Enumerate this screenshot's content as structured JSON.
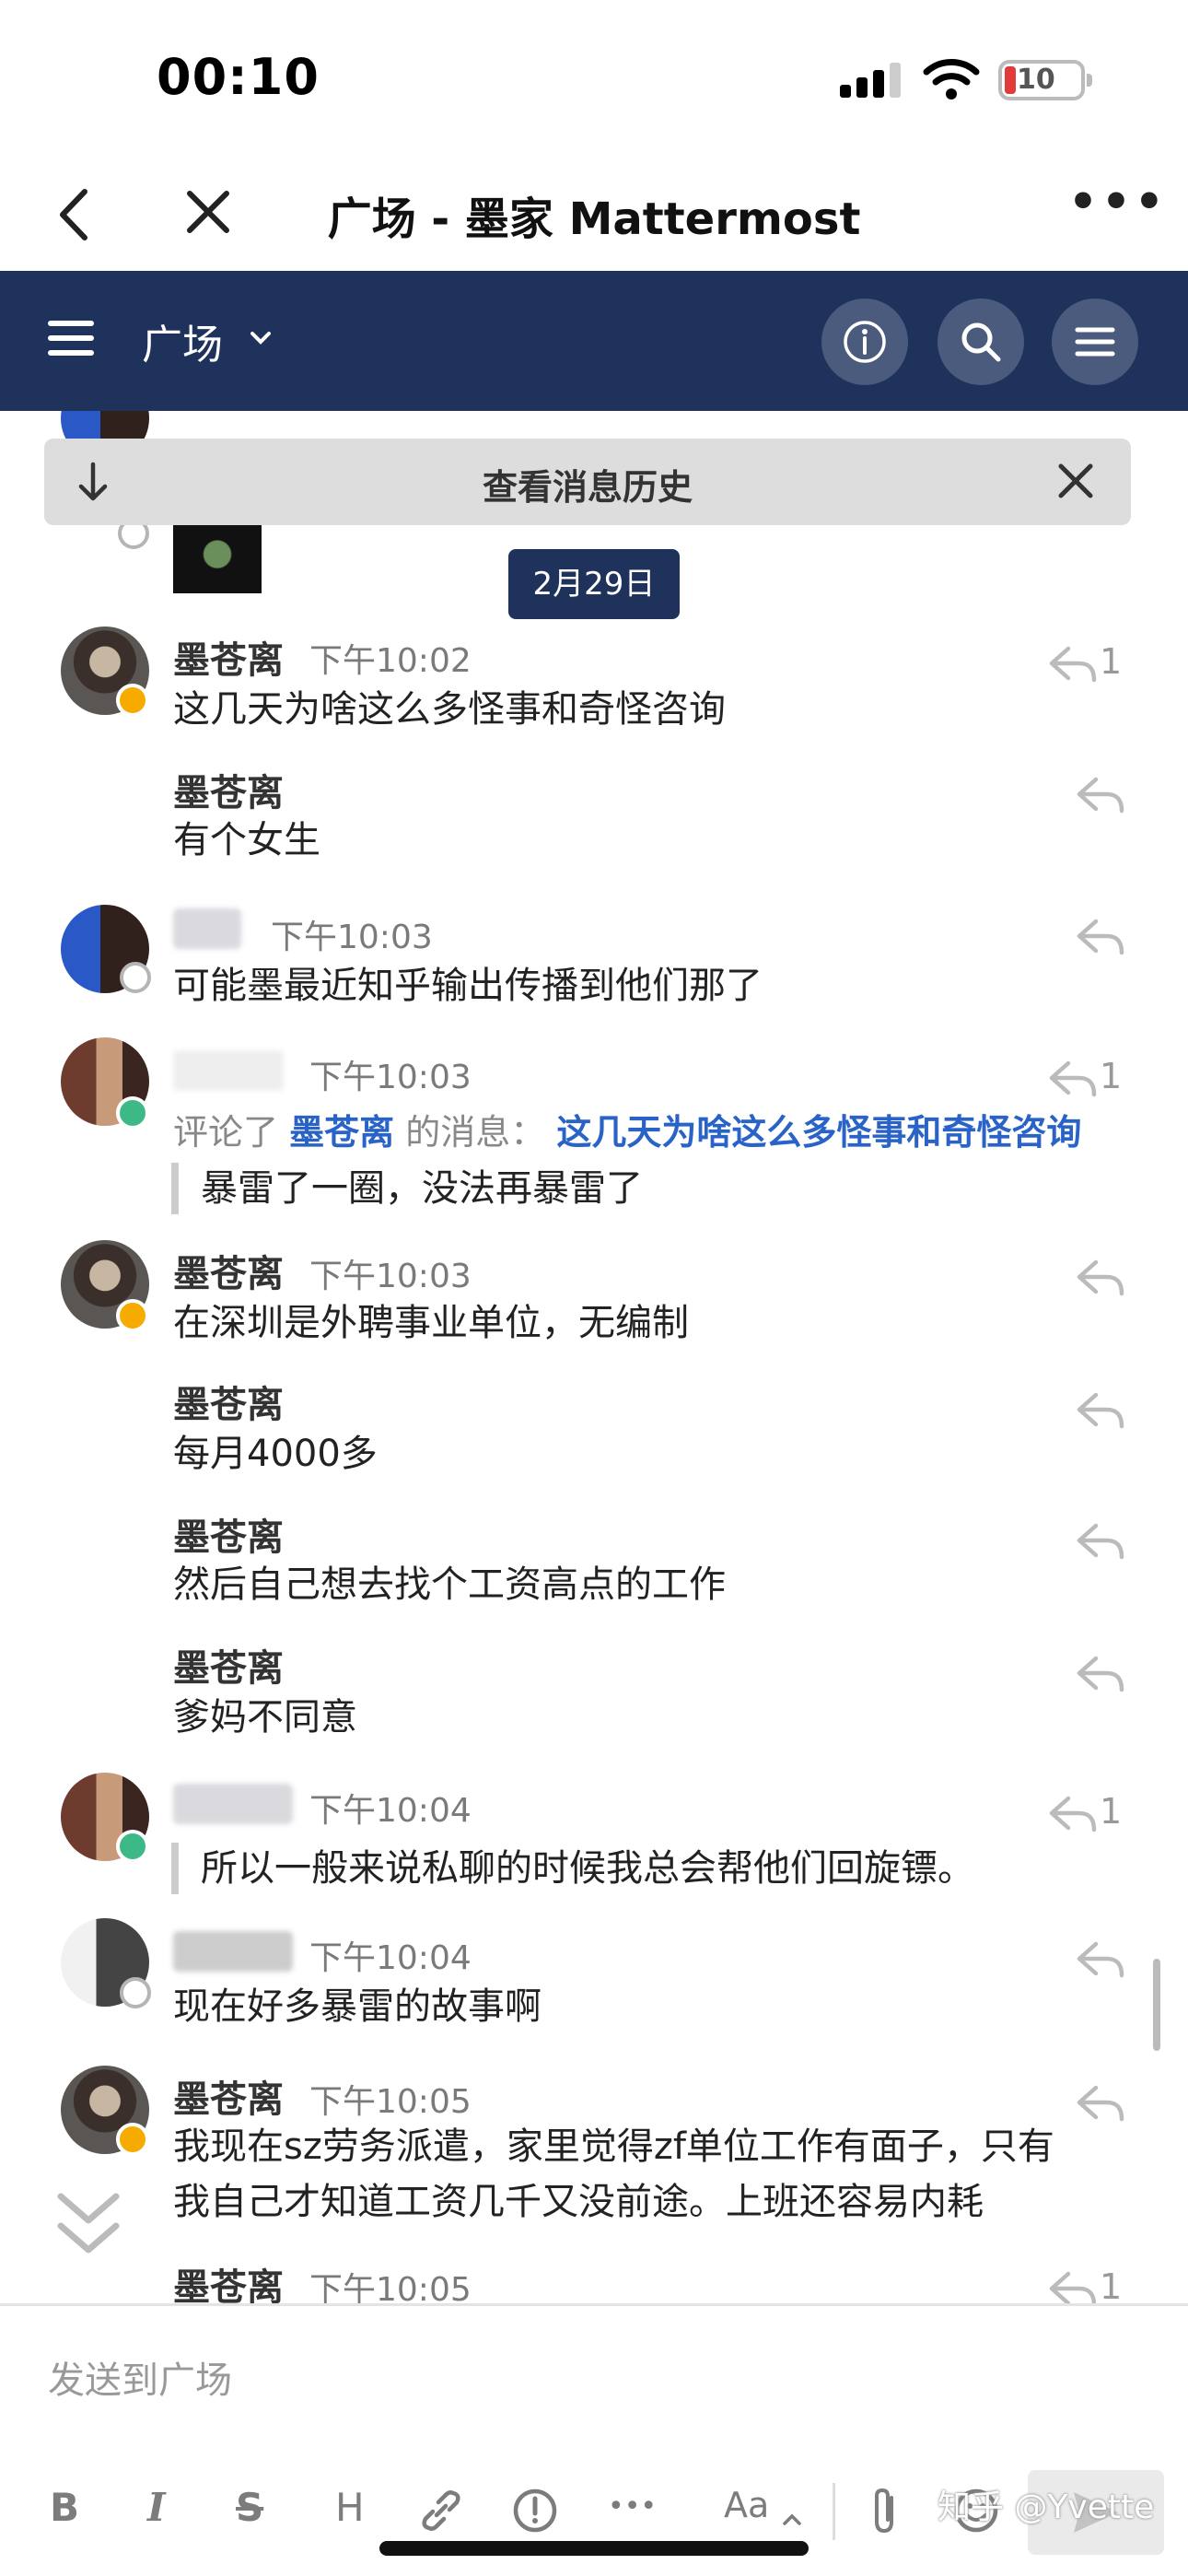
{
  "status_bar": {
    "time": "00:10",
    "battery": "10"
  },
  "browser": {
    "title": "广场 - 墨家 Mattermost"
  },
  "channel": {
    "name": "广场"
  },
  "history_banner": {
    "label": "查看消息历史"
  },
  "date_separator": "2月29日",
  "messages": [
    {
      "sender": "墨苍离",
      "time": "下午10:02",
      "text": "这几天为啥这么多怪事和奇怪咨询",
      "reply_count": "1"
    },
    {
      "sender": "墨苍离",
      "text": "有个女生"
    },
    {
      "time": "下午10:03",
      "text": "可能墨最近知乎输出传播到他们那了"
    },
    {
      "time": "下午10:03",
      "comment_prefix": "评论了",
      "comment_author": "墨苍离",
      "comment_suffix": "的消息：",
      "comment_link": "这几天为啥这么多怪事和奇怪咨询",
      "text": "暴雷了一圈，没法再暴雷了",
      "reply_count": "1"
    },
    {
      "sender": "墨苍离",
      "time": "下午10:03",
      "text": "在深圳是外聘事业单位，无编制"
    },
    {
      "sender": "墨苍离",
      "text": "每月4000多"
    },
    {
      "sender": "墨苍离",
      "text": "然后自己想去找个工资高点的工作"
    },
    {
      "sender": "墨苍离",
      "text": "爹妈不同意"
    },
    {
      "time": "下午10:04",
      "text": "所以一般来说私聊的时候我总会帮他们回旋镖。",
      "reply_count": "1"
    },
    {
      "time": "下午10:04",
      "text": "现在好多暴雷的故事啊"
    },
    {
      "sender": "墨苍离",
      "time": "下午10:05",
      "text_line1": "我现在sz劳务派遣，家里觉得zf单位工作有面子，只有",
      "text_line2": "我自己才知道工资几千又没前途。上班还容易内耗"
    },
    {
      "sender": "墨苍离",
      "time": "下午10:05",
      "reply_count": "1"
    }
  ],
  "input": {
    "placeholder": "发送到广场"
  },
  "toolbar": {
    "bold": "B",
    "italic": "I",
    "strike": "S",
    "heading": "H",
    "more": "•••",
    "format": "Aa"
  },
  "watermark": "知乎 @Yvette",
  "colors": {
    "header_bg": "#1e325c",
    "link": "#2a63c7",
    "away": "#f5ab00",
    "online": "#3db887"
  }
}
